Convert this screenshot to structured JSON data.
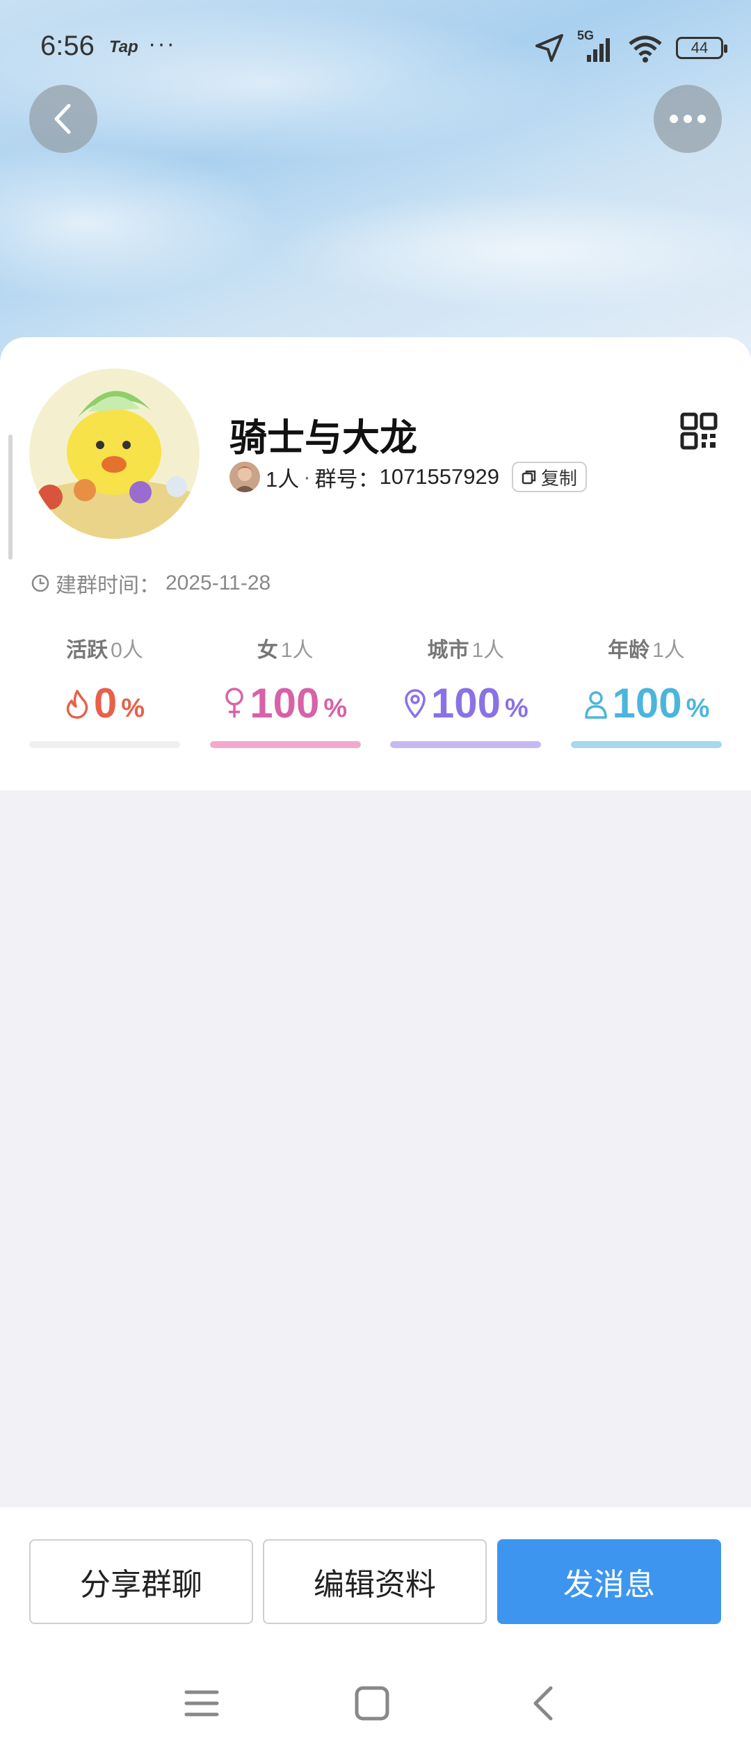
{
  "status_bar": {
    "time": "6:56",
    "app_label": "Tap",
    "dots": "···",
    "network": "5G",
    "battery": "44"
  },
  "group": {
    "name": "骑士与大龙",
    "member_count": "1人",
    "separator": "·",
    "id_label": "群号：",
    "id": "1071557929",
    "copy_label": "复制",
    "created_label": "建群时间：",
    "created_date": "2025-11-28"
  },
  "stats": [
    {
      "label": "活跃",
      "count": "0人",
      "value": "0",
      "pct": "%",
      "color": "#e8604a",
      "bar_color": "#efefef",
      "fill": 0.0,
      "icon": "flame-icon"
    },
    {
      "label": "女",
      "count": "1人",
      "value": "100",
      "pct": "%",
      "color": "#d862a6",
      "bar_color": "#f2a9cd",
      "fill": 1.0,
      "icon": "female-icon"
    },
    {
      "label": "城市",
      "count": "1人",
      "value": "100",
      "pct": "%",
      "color": "#8a72e6",
      "bar_color": "#c6b9f3",
      "fill": 1.0,
      "icon": "location-pin-icon"
    },
    {
      "label": "年龄",
      "count": "1人",
      "value": "100",
      "pct": "%",
      "color": "#4cb5dc",
      "bar_color": "#a7d8ec",
      "fill": 1.0,
      "icon": "person-icon"
    }
  ],
  "actions": {
    "share": "分享群聊",
    "edit": "编辑资料",
    "send": "发消息"
  },
  "colors": {
    "primary": "#3d95f0"
  }
}
